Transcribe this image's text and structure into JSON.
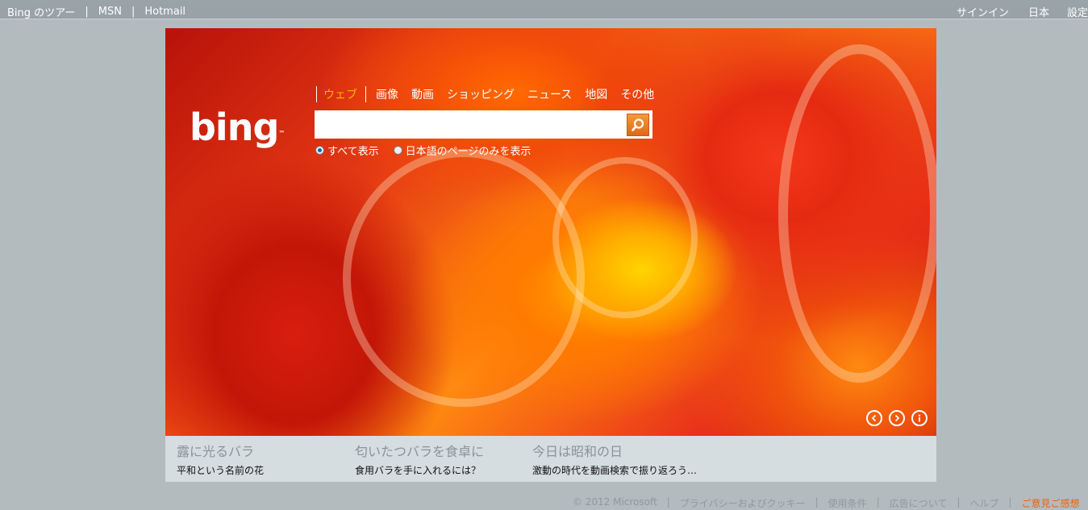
{
  "topbar": {
    "left_links": [
      "Bing のツアー",
      "MSN",
      "Hotmail"
    ],
    "separator": "|",
    "signin": "サインイン",
    "region": "日本",
    "settings": "設定"
  },
  "logo": {
    "text": "bing",
    "tm": "™"
  },
  "nav": {
    "tabs": [
      "ウェブ",
      "画像",
      "動画",
      "ショッピング",
      "ニュース",
      "地図",
      "その他"
    ],
    "active_index": 0
  },
  "search": {
    "value": "",
    "placeholder": ""
  },
  "radios": {
    "options": [
      "すべて表示",
      "日本語のページのみを表示"
    ],
    "selected_index": 0
  },
  "hotspots": [
    {
      "heading": "露に光るバラ",
      "sub": "平和という名前の花"
    },
    {
      "heading": "匂いたつバラを食卓に",
      "sub": "食用バラを手に入れるには？"
    },
    {
      "heading": "今日は昭和の日",
      "sub": "激動の時代を動画検索で振り返ろう…"
    }
  ],
  "footer": {
    "items": [
      "© 2012 Microsoft",
      "|",
      "プライバシーおよびクッキー",
      "|",
      "使用条件",
      "|",
      "広告について",
      "|",
      "ヘルプ",
      "|"
    ],
    "feedback": "ご意見ご感想"
  },
  "colors": {
    "accent_orange": "#e8630d",
    "active_tab": "#f2b800",
    "topbar": "#9aa3a8"
  }
}
